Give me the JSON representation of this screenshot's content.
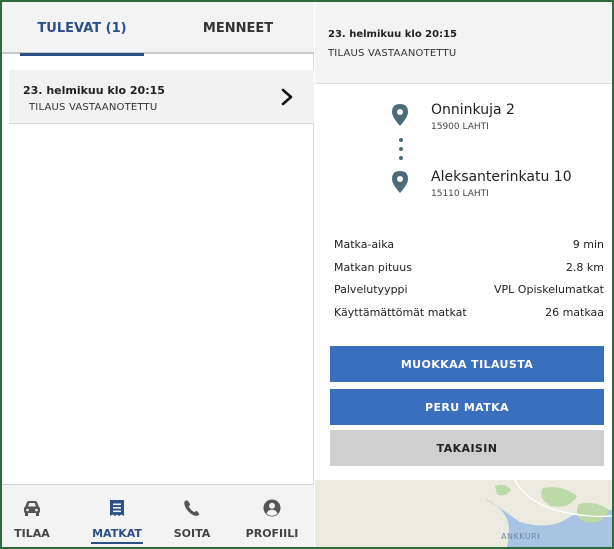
{
  "colors": {
    "accent": "#2c4f86",
    "button_blue": "#3a6fbf",
    "button_gray": "#cfcfcf",
    "frame_green": "#2f6b3a",
    "map_water": "#a9c4e3",
    "map_land": "#eceade",
    "map_green": "#bcd9a8",
    "pin_color": "#4c6b77"
  },
  "tabs": {
    "upcoming": "TULEVAT (1)",
    "past": "MENNEET",
    "active": "upcoming"
  },
  "order": {
    "date": "23. helmikuu  klo 20:15",
    "status": "TILAUS VASTAANOTETTU",
    "icon": "chevron-right-icon"
  },
  "bottom_nav": {
    "items": [
      {
        "label": "TILAA",
        "icon": "car-icon"
      },
      {
        "label": "MATKAT",
        "icon": "receipt-icon"
      },
      {
        "label": "SOITA",
        "icon": "phone-icon"
      },
      {
        "label": "PROFIILI",
        "icon": "profile-icon"
      }
    ],
    "active_index": 1
  },
  "detail": {
    "date": "23. helmikuu  klo 20:15",
    "status": "TILAUS VASTAANOTETTU",
    "from": {
      "street": "Onninkuja 2",
      "zip": "15900 LAHTI"
    },
    "to": {
      "street": "Aleksanterinkatu 10",
      "zip": "15110 LAHTI"
    },
    "info": [
      {
        "label": "Matka-aika",
        "value": "9 min"
      },
      {
        "label": "Matkan pituus",
        "value": "2.8 km"
      },
      {
        "label": "Palvelutyyppi",
        "value": "VPL Opiskelumatkat"
      },
      {
        "label": "Käyttämättömät matkat",
        "value": "26 matkaa"
      }
    ],
    "buttons": {
      "edit": "MUOKKAA TILAUSTA",
      "cancel": "PERU MATKA",
      "back": "TAKAISIN"
    },
    "map_label": "ANKKURI"
  }
}
